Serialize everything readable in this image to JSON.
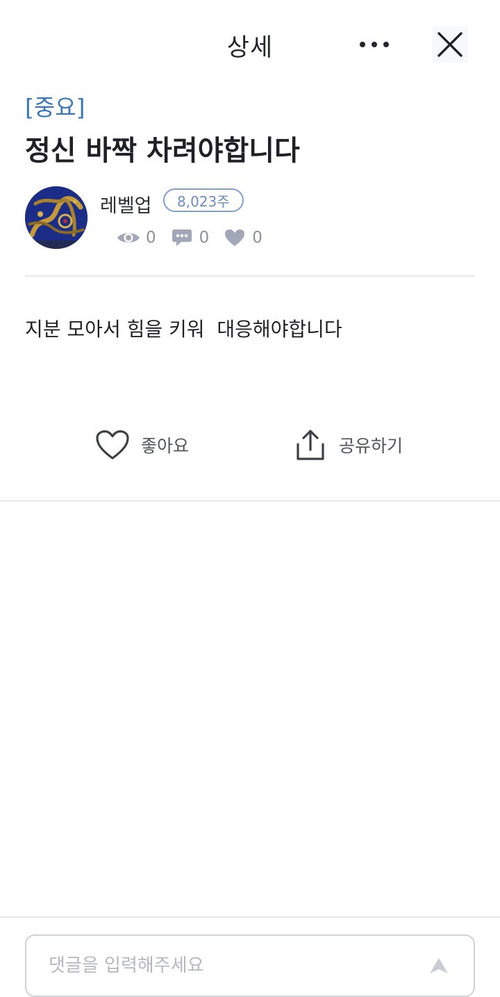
{
  "header": {
    "title": "상세",
    "more_icon": "more-horizontal-icon",
    "close_icon": "close-icon"
  },
  "post": {
    "category": "[중요]",
    "title": "정신 바짝 차려야합니다",
    "author": {
      "name": "레벨업",
      "shares_badge": "8,023주",
      "avatar": "dragon-avatar-image"
    },
    "stats": {
      "views": "0",
      "comments": "0",
      "likes": "0"
    },
    "body": "지분 모아서 힘을 키워  대응해야합니다"
  },
  "actions": {
    "like_label": "좋아요",
    "share_label": "공유하기"
  },
  "comment": {
    "placeholder": "댓글을 입력해주세요",
    "send_icon": "send-arrow-icon"
  },
  "colors": {
    "accent_blue": "#3a77b8",
    "badge_blue": "#7f9fcf",
    "stat_icon": "#a3a8b8",
    "text_dark": "#1f2126"
  }
}
